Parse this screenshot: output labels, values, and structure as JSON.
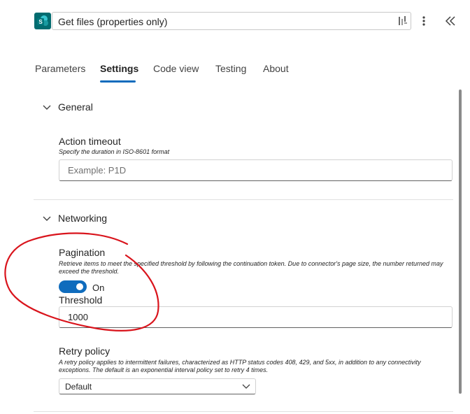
{
  "header": {
    "title": "Get files (properties only)",
    "app_icon": "sharepoint-icon",
    "accent": "#036c70"
  },
  "tabs": [
    {
      "label": "Parameters",
      "active": false
    },
    {
      "label": "Settings",
      "active": true
    },
    {
      "label": "Code view",
      "active": false
    },
    {
      "label": "Testing",
      "active": false
    },
    {
      "label": "About",
      "active": false
    }
  ],
  "general": {
    "title": "General",
    "action_timeout": {
      "label": "Action timeout",
      "description": "Specify the duration in ISO-8601 format",
      "placeholder": "Example: P1D",
      "value": ""
    }
  },
  "networking": {
    "title": "Networking",
    "pagination": {
      "label": "Pagination",
      "description": "Retrieve items to meet the specified threshold by following the continuation token. Due to connector's page size, the number returned may exceed the threshold.",
      "toggle_label": "On",
      "enabled": true
    },
    "threshold": {
      "label": "Threshold",
      "value": "1000"
    },
    "retry_policy": {
      "label": "Retry policy",
      "description": "A retry policy applies to intermittent failures, characterized as HTTP status codes 408, 429, and 5xx, in addition to any connectivity exceptions. The default is an exponential interval policy set to retry 4 times.",
      "selected": "Default"
    }
  },
  "colors": {
    "accent": "#0f6cbd",
    "annotation": "#d9141c"
  }
}
